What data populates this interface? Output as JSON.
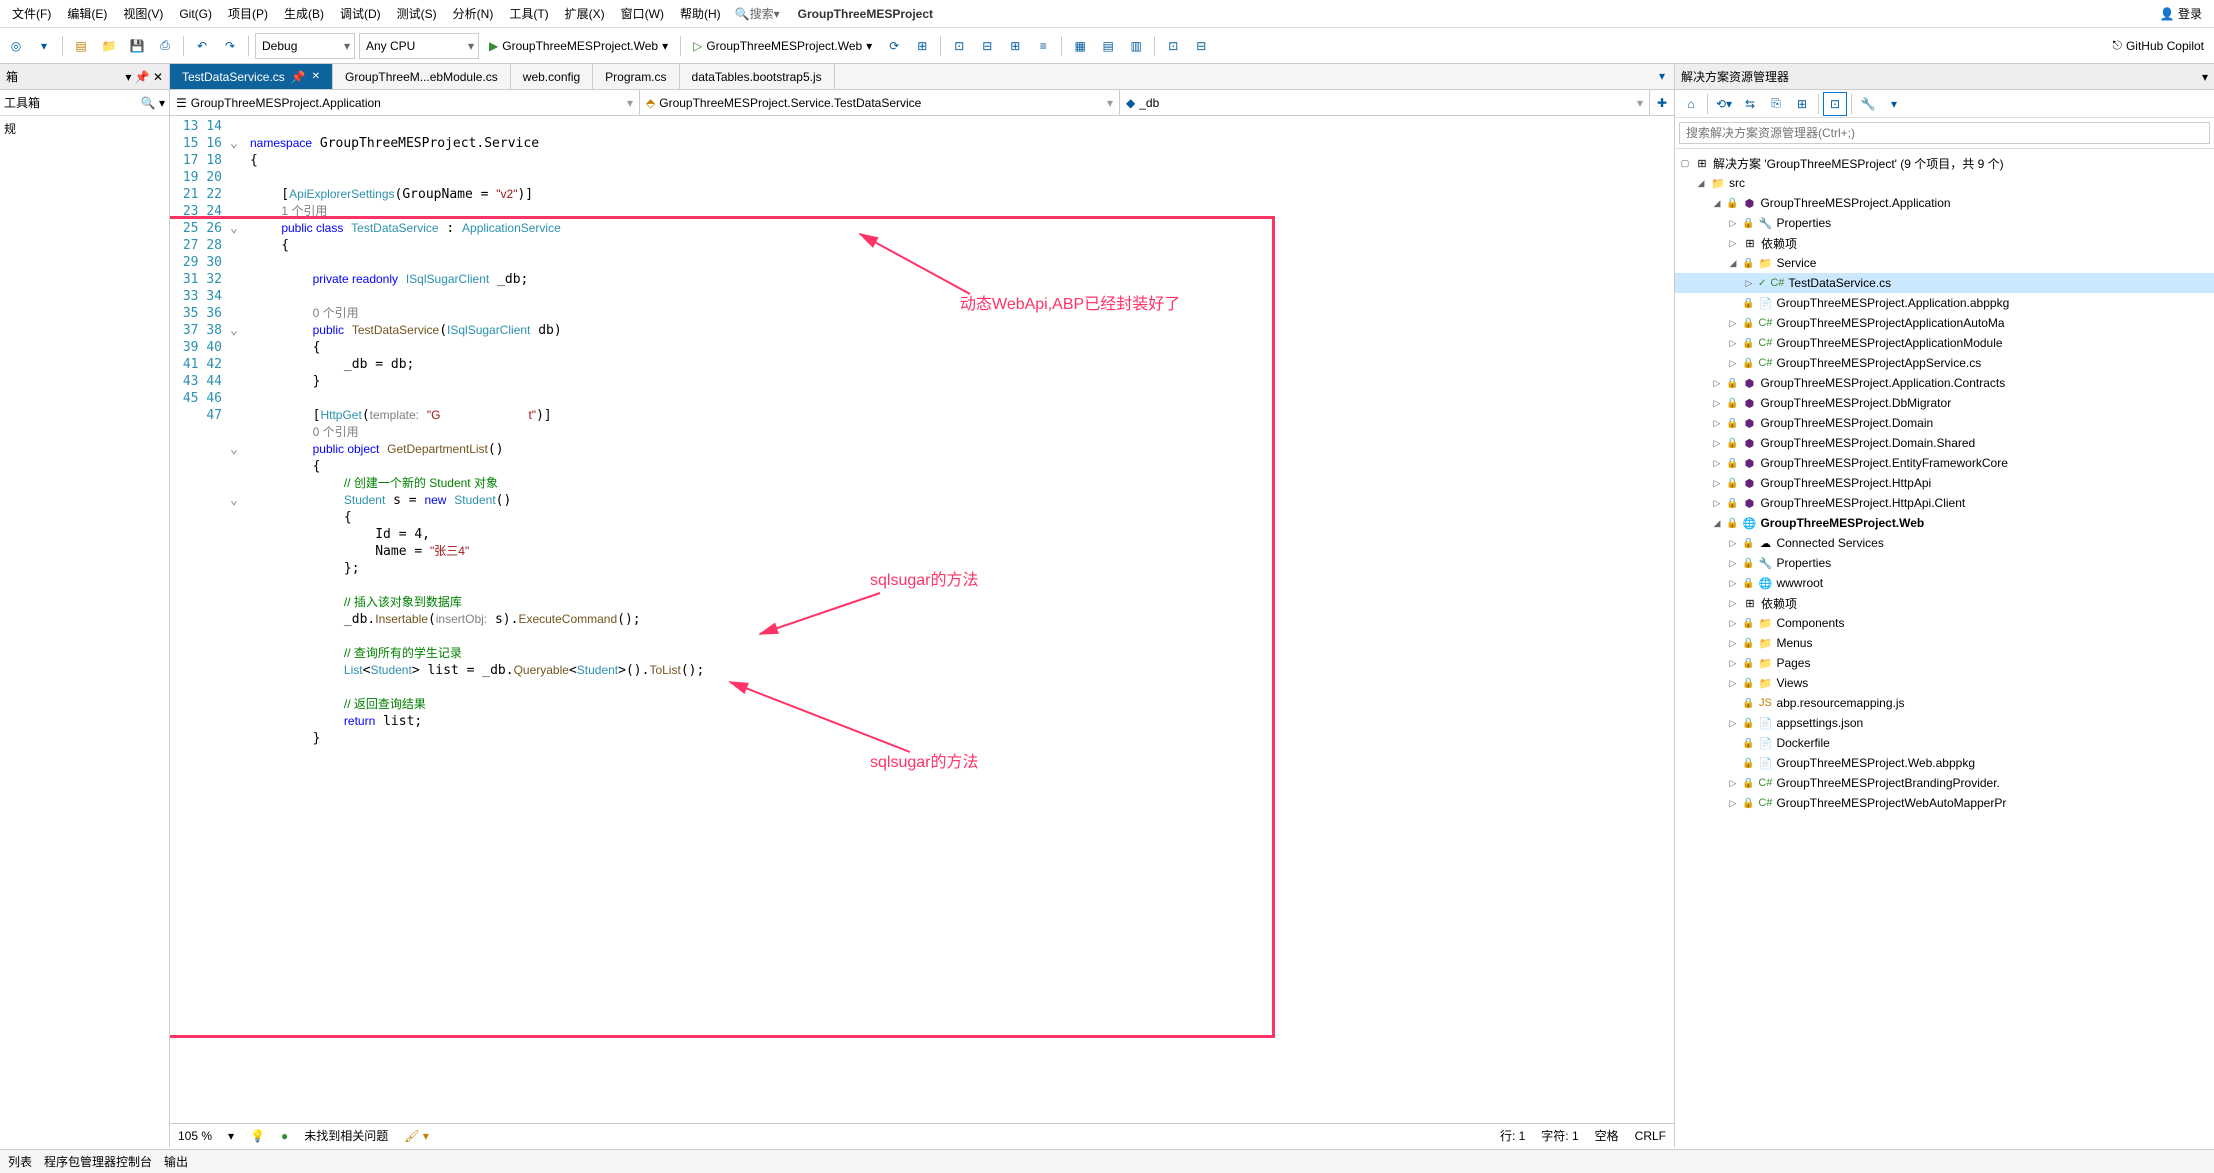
{
  "menubar": {
    "items": [
      "文件(F)",
      "编辑(E)",
      "视图(V)",
      "Git(G)",
      "项目(P)",
      "生成(B)",
      "调试(D)",
      "测试(S)",
      "分析(N)",
      "工具(T)",
      "扩展(X)",
      "窗口(W)",
      "帮助(H)"
    ],
    "search": "搜索",
    "project": "GroupThreeMESProject",
    "login": "登录"
  },
  "toolbar": {
    "config": "Debug",
    "platform": "Any CPU",
    "run1": "GroupThreeMESProject.Web",
    "run2": "GroupThreeMESProject.Web",
    "copilot": "GitHub Copilot"
  },
  "tabs": [
    {
      "label": "TestDataService.cs",
      "active": true
    },
    {
      "label": "GroupThreeM...ebModule.cs"
    },
    {
      "label": "web.config"
    },
    {
      "label": "Program.cs"
    },
    {
      "label": "dataTables.bootstrap5.js"
    }
  ],
  "navbar": {
    "cell1": "GroupThreeMESProject.Application",
    "cell2": "GroupThreeMESProject.Service.TestDataService",
    "cell3": "_db"
  },
  "lines": [
    "13",
    "14",
    "15",
    "16",
    "17",
    "",
    "18",
    "19",
    "20",
    "21",
    "22",
    "",
    "23",
    "24",
    "25",
    "26",
    "27",
    "28",
    "",
    "29",
    "30",
    "31",
    "32",
    "33",
    "34",
    "35",
    "36",
    "37",
    "38",
    "39",
    "40",
    "41",
    "42",
    "43",
    "44",
    "45",
    "46",
    "47"
  ],
  "annotations": {
    "a1": "动态WebApi,ABP已经封装好了",
    "a2": "sqlsugar的方法",
    "a3": "sqlsugar的方法"
  },
  "status": {
    "zoom": "105 %",
    "issues": "未找到相关问题",
    "line": "行: 1",
    "col": "字符: 1",
    "spaces": "空格",
    "eol": "CRLF"
  },
  "bottom": {
    "t1": "列表",
    "t2": "程序包管理器控制台",
    "t3": "输出"
  },
  "rpanel": {
    "title": "解决方案资源管理器",
    "search_ph": "搜索解决方案资源管理器(Ctrl+;)",
    "root": "解决方案 'GroupThreeMESProject' (9 个项目，共 9 个)"
  },
  "tree": {
    "src": "src",
    "app": "GroupThreeMESProject.Application",
    "props": "Properties",
    "deps": "依赖项",
    "service": "Service",
    "testdata": "TestDataService.cs",
    "abppkg": "GroupThreeMESProject.Application.abppkg",
    "automapper": "GroupThreeMESProjectApplicationAutoMa",
    "appmodule": "GroupThreeMESProjectApplicationModule",
    "appservice": "GroupThreeMESProjectAppService.cs",
    "contracts": "GroupThreeMESProject.Application.Contracts",
    "dbmigrator": "GroupThreeMESProject.DbMigrator",
    "domain": "GroupThreeMESProject.Domain",
    "domainshared": "GroupThreeMESProject.Domain.Shared",
    "efcore": "GroupThreeMESProject.EntityFrameworkCore",
    "httpapi": "GroupThreeMESProject.HttpApi",
    "httpapiclient": "GroupThreeMESProject.HttpApi.Client",
    "web": "GroupThreeMESProject.Web",
    "connsvc": "Connected Services",
    "wwwroot": "wwwroot",
    "components": "Components",
    "menus": "Menus",
    "pages": "Pages",
    "views": "Views",
    "resmapping": "abp.resourcemapping.js",
    "appsettings": "appsettings.json",
    "dockerfile": "Dockerfile",
    "webabppkg": "GroupThreeMESProject.Web.abppkg",
    "branding": "GroupThreeMESProjectBrandingProvider.",
    "webautomapper": "GroupThreeMESProjectWebAutoMapperPr"
  }
}
